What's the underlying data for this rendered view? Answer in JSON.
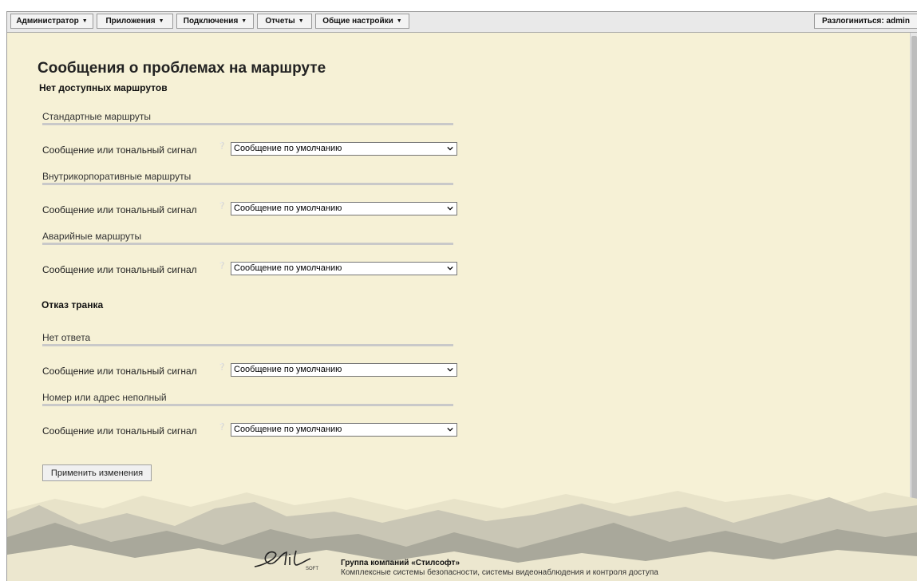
{
  "menu": {
    "admin": "Администратор",
    "apps": "Приложения",
    "connections": "Подключения",
    "reports": "Отчеты",
    "settings": "Общие настройки",
    "logout": "Разлогиниться: admin"
  },
  "page": {
    "title": "Сообщения о проблемах на маршруте",
    "subtitle": "Нет доступных маршрутов",
    "trunk_heading": "Отказ транка"
  },
  "sections": [
    {
      "label": "Стандартные маршруты",
      "field_label": "Сообщение или тональный сигнал",
      "value": "Сообщение по умолчанию"
    },
    {
      "label": "Внутрикорпоративные маршруты",
      "field_label": "Сообщение или тональный сигнал",
      "value": "Сообщение по умолчанию"
    },
    {
      "label": "Аварийные маршруты",
      "field_label": "Сообщение или тональный сигнал",
      "value": "Сообщение по умолчанию"
    },
    {
      "label": "Нет ответа",
      "field_label": "Сообщение или тональный сигнал",
      "value": "Сообщение по умолчанию"
    },
    {
      "label": "Номер или адрес неполный",
      "field_label": "Сообщение или тональный сигнал",
      "value": "Сообщение по умолчанию"
    }
  ],
  "apply_label": "Применить изменения",
  "footer": {
    "company": "Группа компаний «Стилсофт»",
    "tagline": "Комплексные системы безопасности, системы видеонаблюдения и контроля доступа",
    "logo_text": "Stil",
    "logo_sub": "SOFT"
  },
  "icons": {
    "caret": "caret-down-icon",
    "help": "help-icon",
    "select_chevron": "chevron-down-icon"
  }
}
